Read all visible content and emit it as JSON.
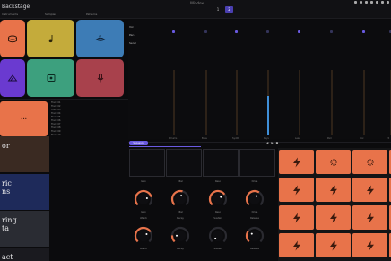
{
  "app": {
    "title": "Backstage",
    "window_title": "Window",
    "top_buttons": [
      "1",
      "2"
    ],
    "tabs": [
      "Instruments",
      "Samples",
      "Patterns"
    ]
  },
  "instrument_pads": [
    {
      "name": "drum",
      "color": "#e8734a",
      "icon": "drum-icon"
    },
    {
      "name": "note",
      "color": "#c4ab3b",
      "icon": "music-note-icon"
    },
    {
      "name": "bass",
      "color": "#3d7cb6",
      "icon": "submarine-icon"
    },
    {
      "name": "synth",
      "color": "#6a3ad0",
      "icon": "piano-keys-icon"
    },
    {
      "name": "sampler",
      "color": "#3da07e",
      "icon": "sample-pad-icon"
    },
    {
      "name": "vocal",
      "color": "#a8414c",
      "icon": "microphone-icon"
    }
  ],
  "track_card": {
    "label": "•••"
  },
  "track_list": {
    "rows": [
      "Track 01",
      "Track 02",
      "Track 03",
      "Track 04",
      "Track 05",
      "Track 06",
      "Track 07",
      "Track 08",
      "Track 09",
      "Track 10"
    ]
  },
  "thumbnails": [
    {
      "text": "or",
      "color": "#3a2a22"
    },
    {
      "text": "ric\nns",
      "color": "#1e2a5a"
    },
    {
      "text": "ring\nta",
      "color": "#2a2c33"
    },
    {
      "text": "act",
      "color": "#1a1a1f"
    }
  ],
  "mixer": {
    "side_labels": [
      "Vol",
      "Pan",
      "Send"
    ],
    "channels": [
      {
        "label": "Drums",
        "level": 0.0,
        "foot": "Drums"
      },
      {
        "label": "Bass",
        "level": 0.0,
        "foot": "Bass"
      },
      {
        "label": "Synth",
        "level": 0.0,
        "foot": "Synth"
      },
      {
        "label": "Keys",
        "level": 0.6,
        "foot": "Keys"
      },
      {
        "label": "Lead",
        "level": 0.0,
        "foot": "Lead"
      },
      {
        "label": "Pad",
        "level": 0.0,
        "foot": "Pad"
      },
      {
        "label": "Vox",
        "level": 0.0,
        "foot": "Vox"
      },
      {
        "label": "FX",
        "level": 0.0,
        "foot": "FX"
      }
    ]
  },
  "sequencer": {
    "tab_label": "Sequence",
    "controls": [
      "◀",
      "▶",
      "●"
    ]
  },
  "knobs": [
    {
      "label": "Gain",
      "value": 0.78
    },
    {
      "label": "Filter",
      "value": 0.56
    },
    {
      "label": "Reso",
      "value": 0.7
    },
    {
      "label": "Drive",
      "value": 0.62
    },
    {
      "label": "Attack",
      "value": 0.72
    },
    {
      "label": "Decay",
      "value": 0.18
    },
    {
      "label": "Sustain",
      "value": 0.0
    },
    {
      "label": "Release",
      "value": 0.3
    }
  ],
  "trigger_pads": [
    "bolt",
    "burst",
    "burst",
    "bolt",
    "bolt",
    "bolt",
    "bolt",
    "bolt",
    "bolt",
    "bolt",
    "bolt",
    "bolt",
    "bolt",
    "bolt",
    "bolt",
    "bolt"
  ]
}
